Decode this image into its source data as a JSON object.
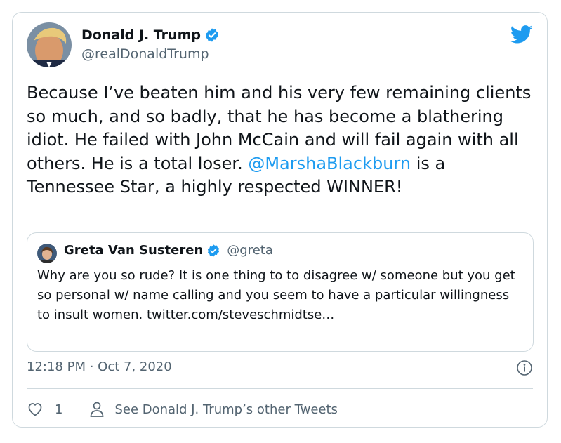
{
  "tweet": {
    "author_name": "Donald J. Trump",
    "author_handle": "@realDonaldTrump",
    "text_part1": "Because I’ve beaten him and his very few remaining clients so much, and so badly, that he has become a blathering idiot. He failed with John McCain and will fail again with all others. He is a total loser. ",
    "mention": "@MarshaBlackburn",
    "text_part2": " is a Tennessee Star, a highly respected WINNER!",
    "timestamp": "12:18 PM · Oct 7, 2020",
    "like_count": "1",
    "other_tweets_label": "See Donald J. Trump’s other Tweets"
  },
  "quoted_tweet": {
    "author_name": "Greta Van Susteren",
    "author_handle": "@greta",
    "text": "Why are you so rude? It is one thing to to disagree w/ someone but you get so personal w/ name calling and you seem to have a particular willingness to insult women. twitter.com/steveschmidtse…"
  },
  "colors": {
    "accent": "#1d9bf0",
    "secondary_text": "#536471",
    "border": "#cfd9de"
  },
  "icons": [
    "verified-badge-icon",
    "twitter-bird-icon",
    "info-icon",
    "heart-icon",
    "person-icon"
  ]
}
